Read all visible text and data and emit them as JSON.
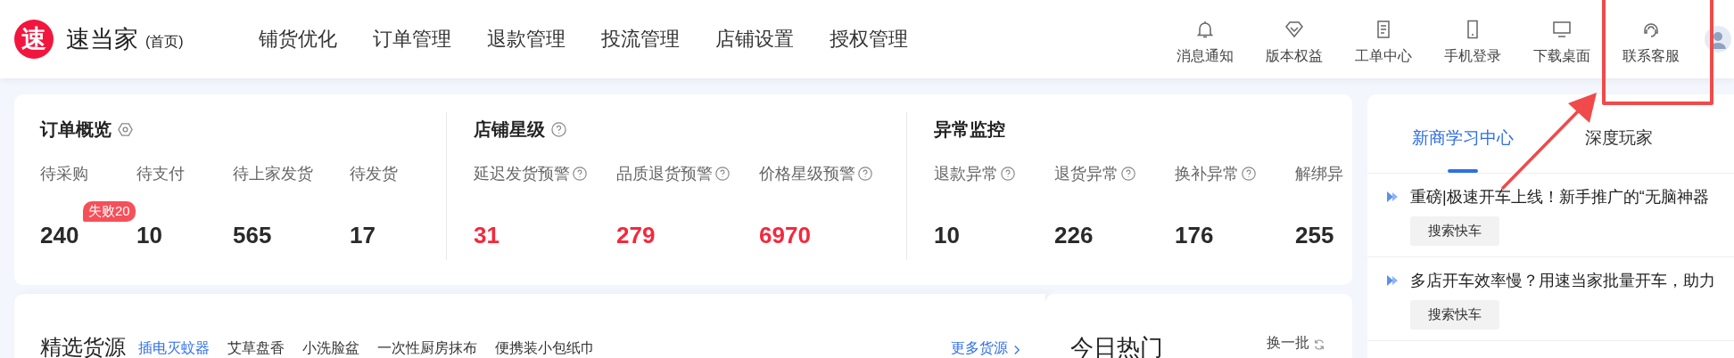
{
  "header": {
    "logo_char": "速",
    "brand": "速当家",
    "brand_sub": "(首页)",
    "nav": [
      {
        "label": "铺货优化"
      },
      {
        "label": "订单管理"
      },
      {
        "label": "退款管理"
      },
      {
        "label": "投流管理"
      },
      {
        "label": "店铺设置"
      },
      {
        "label": "授权管理"
      }
    ],
    "tools": [
      {
        "kind": "bell",
        "label": "消息通知",
        "highlighted": false
      },
      {
        "kind": "diamond",
        "label": "版本权益",
        "highlighted": false
      },
      {
        "kind": "clipboard",
        "label": "工单中心",
        "highlighted": false
      },
      {
        "kind": "phone",
        "label": "手机登录",
        "highlighted": false
      },
      {
        "kind": "monitor",
        "label": "下载桌面",
        "highlighted": false
      },
      {
        "kind": "headset",
        "label": "联系客服",
        "highlighted": true
      }
    ]
  },
  "overview": {
    "sections": [
      {
        "title": "订单概览",
        "settings_icon": true,
        "help_icon": false,
        "items": [
          {
            "label": "待采购",
            "help": false,
            "value": "240",
            "alert": false,
            "badge": "失败20"
          },
          {
            "label": "待支付",
            "help": false,
            "value": "10",
            "alert": false
          },
          {
            "label": "待上家发货",
            "help": false,
            "value": "565",
            "alert": false
          },
          {
            "label": "待发货",
            "help": false,
            "value": "17",
            "alert": false
          }
        ]
      },
      {
        "title": "店铺星级",
        "settings_icon": false,
        "help_icon": true,
        "items": [
          {
            "label": "延迟发货预警",
            "help": true,
            "value": "31",
            "alert": true
          },
          {
            "label": "品质退货预警",
            "help": true,
            "value": "279",
            "alert": true
          },
          {
            "label": "价格星级预警",
            "help": true,
            "value": "6970",
            "alert": true
          }
        ]
      },
      {
        "title": "异常监控",
        "settings_icon": false,
        "help_icon": false,
        "items": [
          {
            "label": "退款异常",
            "help": true,
            "value": "10",
            "alert": false
          },
          {
            "label": "退货异常",
            "help": true,
            "value": "226",
            "alert": false
          },
          {
            "label": "换补异常",
            "help": true,
            "value": "176",
            "alert": false
          },
          {
            "label": "解绑异",
            "help": false,
            "value": "255",
            "alert": false
          }
        ]
      }
    ]
  },
  "sources": {
    "title": "精选货源",
    "tags": [
      {
        "label": "插电灭蚊器",
        "selected": true
      },
      {
        "label": "艾草盘香",
        "selected": false
      },
      {
        "label": "小洗脸盆",
        "selected": false
      },
      {
        "label": "一次性厨房抹布",
        "selected": false
      },
      {
        "label": "便携装小包纸巾",
        "selected": false
      }
    ],
    "more": "更多货源"
  },
  "hot": {
    "title": "今日热门",
    "refresh": "换一批"
  },
  "learning": {
    "tabs": [
      {
        "label": "新商学习中心",
        "selected": true
      },
      {
        "label": "深度玩家",
        "selected": false
      }
    ],
    "articles": [
      {
        "title": "重磅|极速开车上线！新手推广的“无脑神器",
        "tag": "搜索快车"
      },
      {
        "title": "多店开车效率慢？用速当家批量开车，助力",
        "tag": "搜索快车"
      }
    ]
  }
}
